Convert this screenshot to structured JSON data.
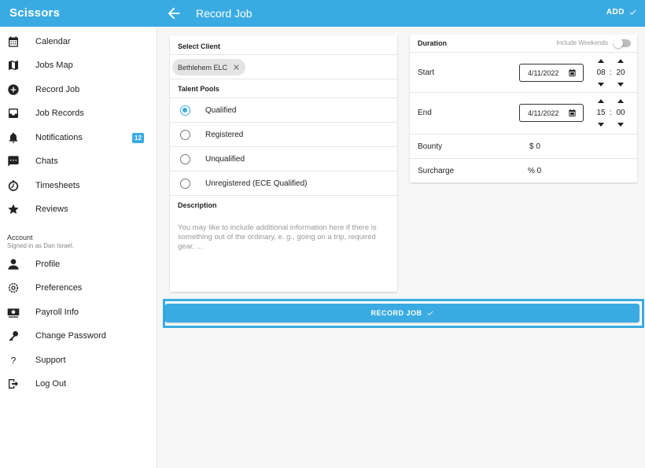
{
  "app": {
    "title": "Scissors"
  },
  "header": {
    "title": "Record Job",
    "add_label": "ADD"
  },
  "colors": {
    "accent": "#3aabe2"
  },
  "sidebar": {
    "items": [
      {
        "label": "Calendar",
        "icon": "calendar-icon"
      },
      {
        "label": "Jobs Map",
        "icon": "map-icon"
      },
      {
        "label": "Record Job",
        "icon": "add-circle-icon"
      },
      {
        "label": "Job Records",
        "icon": "inbox-icon"
      },
      {
        "label": "Notifications",
        "icon": "bell-icon",
        "badge": "12"
      },
      {
        "label": "Chats",
        "icon": "chat-icon"
      },
      {
        "label": "Timesheets",
        "icon": "timer-icon"
      },
      {
        "label": "Reviews",
        "icon": "star-icon"
      }
    ],
    "account": {
      "heading": "Account",
      "signed_in": "Signed in as Dan Israel.",
      "items": [
        {
          "label": "Profile",
          "icon": "person-icon"
        },
        {
          "label": "Preferences",
          "icon": "settings-icon"
        },
        {
          "label": "Payroll Info",
          "icon": "cash-icon"
        },
        {
          "label": "Change Password",
          "icon": "key-icon"
        },
        {
          "label": "Support",
          "icon": "help-icon"
        },
        {
          "label": "Log Out",
          "icon": "logout-icon"
        }
      ]
    }
  },
  "form": {
    "select_client": {
      "heading": "Select Client",
      "chip": "Bethlehem ELC"
    },
    "talent_pools": {
      "heading": "Talent Pools",
      "options": [
        "Qualified",
        "Registered",
        "Unqualified",
        "Unregistered (ECE Qualified)"
      ],
      "selected": "Qualified"
    },
    "description": {
      "heading": "Description",
      "placeholder": "You may like to include additional information here if there is something out of the ordinary, e. g., going on a trip, required gear, ..."
    }
  },
  "duration": {
    "heading": "Duration",
    "weekends_label": "Include Weekends",
    "weekends_on": false,
    "start": {
      "label": "Start",
      "date": "4/11/2022",
      "hour": "08",
      "minute": "20"
    },
    "end": {
      "label": "End",
      "date": "4/11/2022",
      "hour": "15",
      "minute": "00"
    },
    "time_separator": ":",
    "bounty": {
      "label": "Bounty",
      "value": "$ 0"
    },
    "surcharge": {
      "label": "Surcharge",
      "value": "% 0"
    }
  },
  "record_button": {
    "label": "RECORD JOB"
  }
}
